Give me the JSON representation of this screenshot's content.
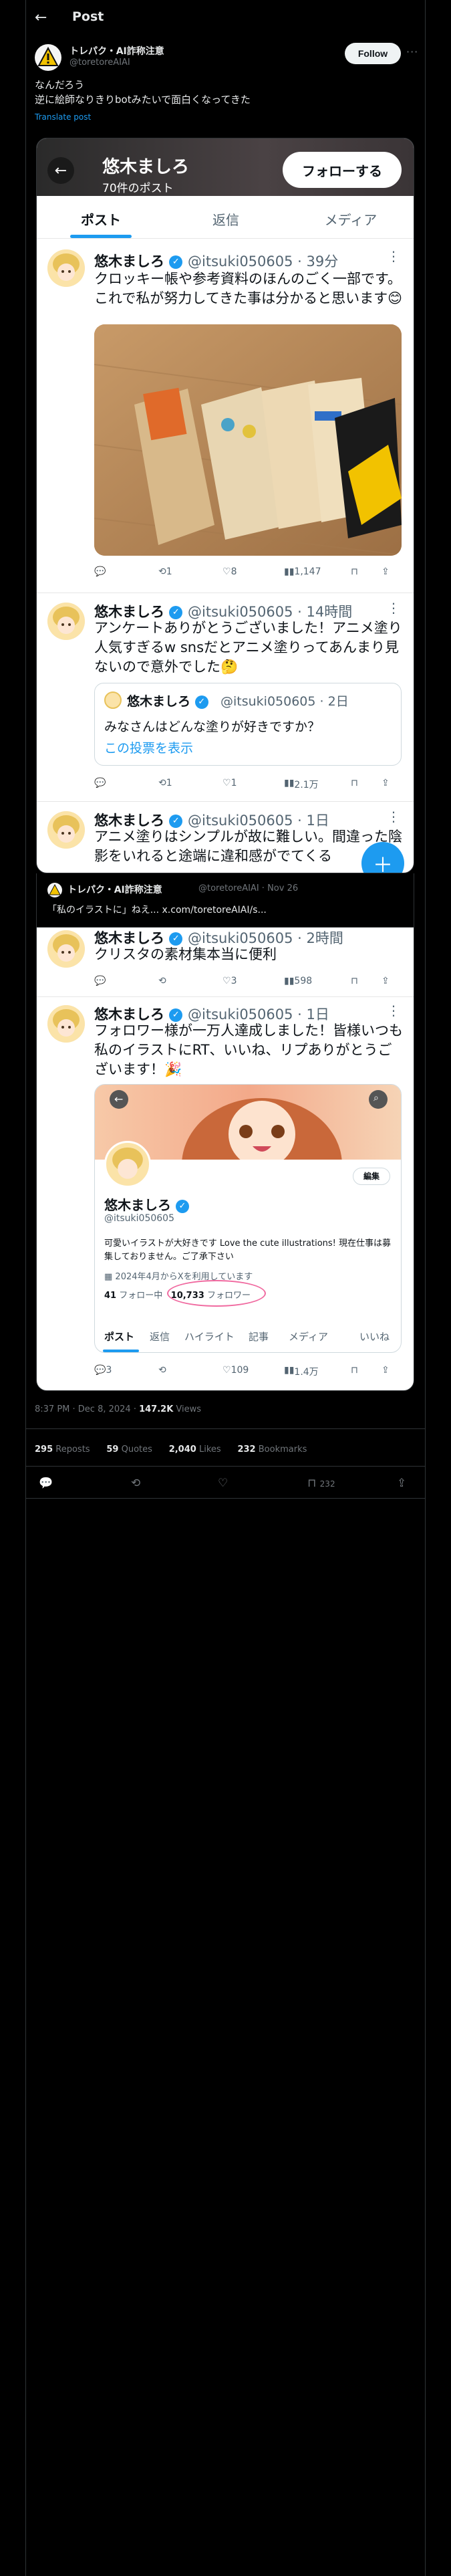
{
  "header": {
    "title": "Post"
  },
  "author": {
    "name": "トレパク・AI詐称注意",
    "handle": "@toretoreAIAI",
    "follow_label": "Follow"
  },
  "tweet": {
    "line1": "なんだろう",
    "line2": "逆に絵師なりきりbotみたいで面白くなってきた",
    "translate": "Translate post"
  },
  "profile_shot": {
    "name": "悠木ましろ",
    "post_count": "70件のポスト",
    "follow_label": "フォローする",
    "tabs": [
      "ポスト",
      "返信",
      "メディア"
    ],
    "tweets": [
      {
        "name": "悠木ましろ",
        "handle": "@itsuki050605 · 39分",
        "text": "クロッキー帳や参考資料のほんのごく一部です。これで私が努力してきた事は分かると思います😊",
        "replies": "",
        "retweets": "1",
        "likes": "8",
        "views": "1,147"
      },
      {
        "name": "悠木ましろ",
        "handle": "@itsuki050605 · 14時間",
        "text": "アンケートありがとうございました！アニメ塗り人気すぎるw snsだとアニメ塗りってあんまり見ないので意外でした🤔",
        "replies": "",
        "retweets": "1",
        "likes": "1",
        "views": "2.1万",
        "quote": {
          "name": "悠木ましろ",
          "handle": "@itsuki050605 · 2日",
          "text": "みなさんはどんな塗りが好きですか？",
          "link": "この投票を表示"
        }
      },
      {
        "name": "悠木ましろ",
        "handle": "@itsuki050605 · 1日",
        "text": "アニメ塗りはシンプルが故に難しい。間違った陰影をいれると途端に違和感がでてくる"
      }
    ]
  },
  "quote_bar": {
    "name": "トレパク・AI詐称注意",
    "handle": "@toretoreAIAI · Nov 26",
    "text": "「私のイラストに」ねえ... x.com/toretoreAIAI/s..."
  },
  "second_shot": {
    "tweets": [
      {
        "name": "悠木ましろ",
        "handle": "@itsuki050605 · 2時間",
        "text": "クリスタの素材集本当に便利",
        "replies": "",
        "retweets": "",
        "likes": "3",
        "views": "598"
      },
      {
        "name": "悠木ましろ",
        "handle": "@itsuki050605 · 1日",
        "text": "フォロワー様が一万人達成しました！皆様いつも私のイラストにRT、いいね、リプありがとうございます！🎉",
        "replies": "3",
        "retweets": "",
        "likes": "109",
        "views": "1.4万"
      }
    ],
    "card": {
      "name": "悠木ましろ",
      "handle": "@itsuki050605",
      "edit_label": "編集",
      "bio": "可愛いイラストが大好きです Love the cute illustrations! 現在仕事は募集しておりません。ご了承下さい",
      "joined": "2024年4月からXを利用しています",
      "following_count": "41",
      "following_label": "フォロー中",
      "followers_count": "10,733",
      "followers_label": "フォロワー",
      "tabs": [
        "ポスト",
        "返信",
        "ハイライト",
        "記事",
        "メディア",
        "いいね"
      ]
    }
  },
  "meta": {
    "time": "8:37 PM · Dec 8, 2024 · ",
    "views_count": "147.2K",
    "views_label": " Views"
  },
  "stats": {
    "reposts": "295",
    "reposts_label": "Reposts",
    "quotes": "59",
    "quotes_label": "Quotes",
    "likes": "2,040",
    "likes_label": "Likes",
    "bookmarks": "232",
    "bookmarks_label": "Bookmarks"
  },
  "actionbar": {
    "bookmark_count": "232"
  },
  "colors": {
    "accent": "#1d9bf0",
    "bg": "#000000",
    "text": "#e7e9ea",
    "muted": "#71767b",
    "highlight_circle": "#f06aa0"
  }
}
